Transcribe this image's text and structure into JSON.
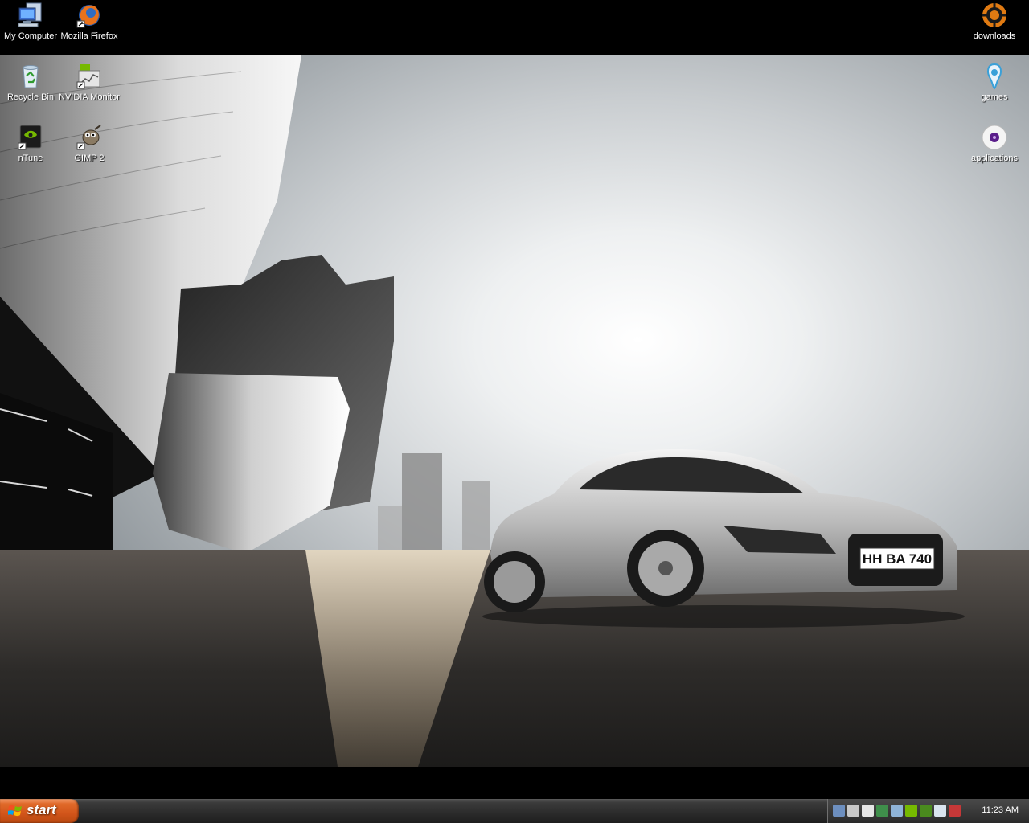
{
  "desktop": {
    "icons_left": [
      {
        "name": "my-computer-icon",
        "label": "My Computer"
      },
      {
        "name": "firefox-icon",
        "label": "Mozilla Firefox"
      },
      {
        "name": "recycle-bin-icon",
        "label": "Recycle Bin"
      },
      {
        "name": "nvidia-monitor-icon",
        "label": "NVIDIA Monitor"
      },
      {
        "name": "ntune-icon",
        "label": "nTune"
      },
      {
        "name": "gimp-icon",
        "label": "GIMP 2"
      }
    ],
    "icons_right": [
      {
        "name": "downloads-icon",
        "label": "downloads"
      },
      {
        "name": "games-icon",
        "label": "games"
      },
      {
        "name": "applications-icon",
        "label": "applications"
      }
    ],
    "wallpaper": {
      "plate": "HH BA 740"
    }
  },
  "taskbar": {
    "start_label": "start",
    "tray_icons": [
      "network-icon",
      "steam-icon",
      "display-icon",
      "sync-icon",
      "pen-icon",
      "nvidia-tray-icon",
      "nvidia-tray-icon-2",
      "volume-icon",
      "shield-icon"
    ],
    "clock": "11:23 AM"
  },
  "colors": {
    "start": "#d2551a",
    "taskbar": "#2b2b2b",
    "accent_nvidia": "#76b900",
    "firefox_orange": "#e8721c"
  }
}
